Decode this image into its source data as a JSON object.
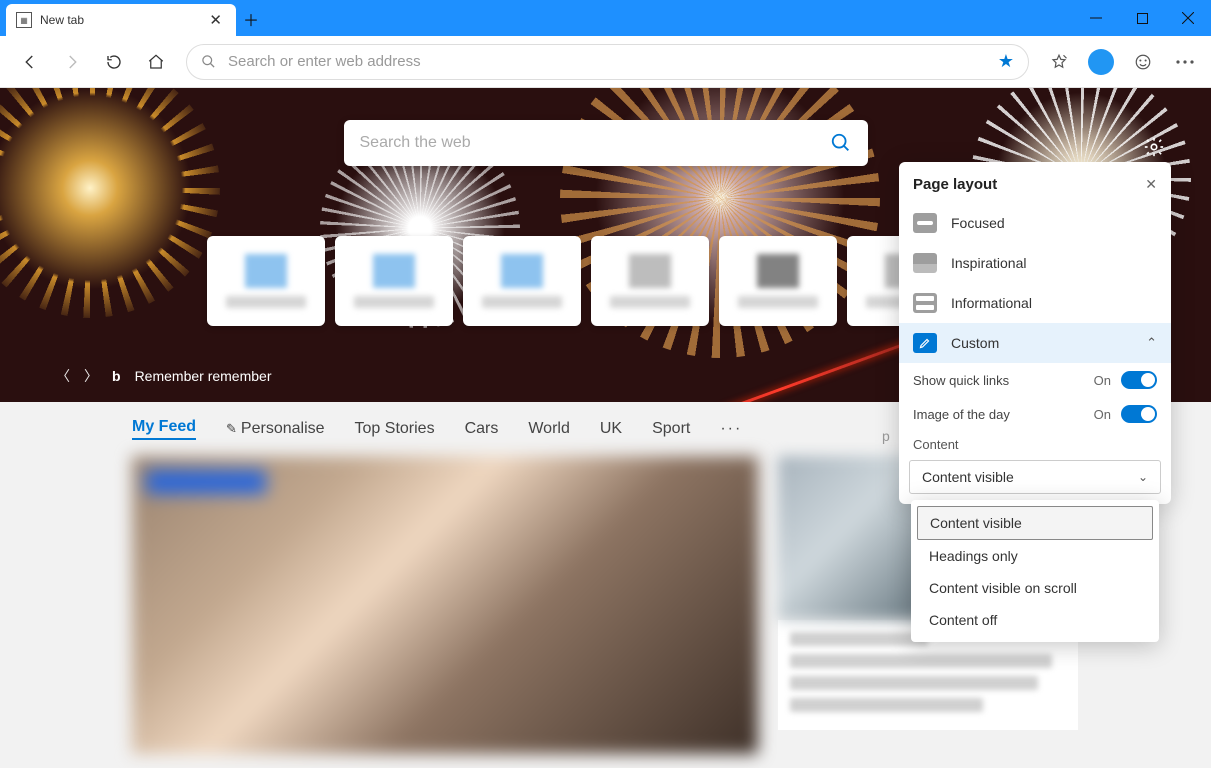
{
  "window": {
    "tab_title": "New tab"
  },
  "nav": {
    "address_placeholder": "Search or enter web address"
  },
  "hero": {
    "search_placeholder": "Search the web",
    "caption": "Remember remember"
  },
  "feed": {
    "tabs": {
      "my_feed": "My Feed",
      "personalise": "Personalise",
      "top_stories": "Top Stories",
      "cars": "Cars",
      "world": "World",
      "uk": "UK",
      "sport": "Sport"
    },
    "powered_hint": "p"
  },
  "panel": {
    "title": "Page layout",
    "options": {
      "focused": "Focused",
      "inspirational": "Inspirational",
      "informational": "Informational",
      "custom": "Custom"
    },
    "quick_links": {
      "label": "Show quick links",
      "state": "On"
    },
    "image_of_day": {
      "label": "Image of the day",
      "state": "On"
    },
    "content_label": "Content",
    "content_value": "Content visible",
    "content_options": {
      "visible": "Content visible",
      "headings": "Headings only",
      "scroll": "Content visible on scroll",
      "off": "Content off"
    }
  }
}
